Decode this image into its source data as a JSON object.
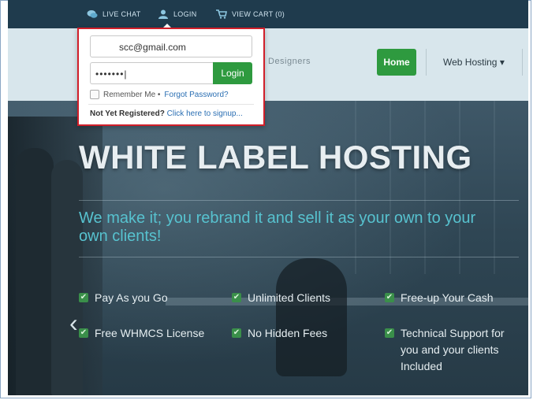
{
  "topbar": {
    "live_chat": "LIVE CHAT",
    "login": "LOGIN",
    "view_cart": "VIEW CART (0)"
  },
  "header": {
    "brand_subtitle": "Designers",
    "nav": {
      "home": "Home",
      "web_hosting": "Web Hosting ▾"
    }
  },
  "login_panel": {
    "email_value": "scc@gmail.com",
    "password_mask": "•••••••|",
    "login_button": "Login",
    "remember_me": "Remember Me •",
    "forgot_password": "Forgot Password?",
    "not_registered": "Not Yet Registered?",
    "signup_link": "Click here to signup..."
  },
  "hero": {
    "title": "WHITE LABEL HOSTING",
    "subtitle": "We make it; you rebrand it and sell it as your own to your own clients!",
    "features": [
      "Pay As you Go",
      "Unlimited Clients",
      "Free-up Your Cash",
      "Free WHMCS License",
      "No Hidden Fees",
      "Technical Support for you and your clients Included"
    ],
    "prev_arrow": "‹"
  },
  "colors": {
    "topbar_bg": "#1f3b4d",
    "header_bg": "#d8e6ec",
    "accent_green": "#2e9a3f",
    "highlight_red": "#d11f2a",
    "subtitle_teal": "#57c2cf",
    "link_blue": "#2b6fb3"
  },
  "icons": {
    "live_chat": "chat-bubbles-icon",
    "login": "user-icon",
    "cart": "cart-icon",
    "feature_check": "check-icon",
    "prev": "chevron-left-icon"
  }
}
